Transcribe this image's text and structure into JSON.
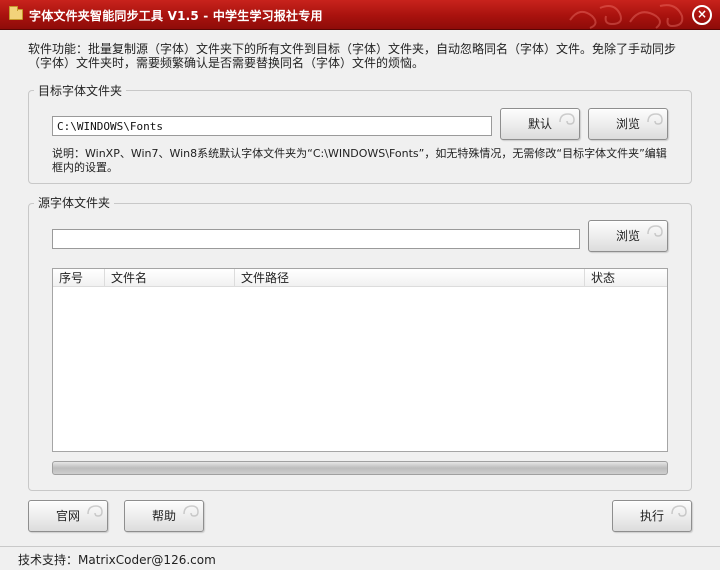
{
  "window": {
    "title": "字体文件夹智能同步工具 V1.5 - 中学生学习报社专用",
    "close_glyph": "×"
  },
  "description": "软件功能：批量复制源（字体）文件夹下的所有文件到目标（字体）文件夹，自动忽略同名（字体）文件。免除了手动同步（字体）文件夹时，需要频繁确认是否需要替换同名（字体）文件的烦恼。",
  "target": {
    "group_label": "目标字体文件夹",
    "path_value": "C:\\WINDOWS\\Fonts",
    "default_label": "默认",
    "browse_label": "浏览",
    "note": "说明：WinXP、Win7、Win8系统默认字体文件夹为“C:\\WINDOWS\\Fonts”，如无特殊情况，无需修改“目标字体文件夹”编辑框内的设置。"
  },
  "source": {
    "group_label": "源字体文件夹",
    "path_value": "",
    "browse_label": "浏览",
    "columns": [
      "序号",
      "文件名",
      "文件路径",
      "状态"
    ],
    "rows": [],
    "progress": 0
  },
  "footer": {
    "website_label": "官网",
    "help_label": "帮助",
    "execute_label": "执行"
  },
  "status": {
    "support_text": "技术支持：MatrixCoder@126.com"
  },
  "colors": {
    "titlebar": "#b01a14",
    "progress_fill": "#46c34a"
  }
}
